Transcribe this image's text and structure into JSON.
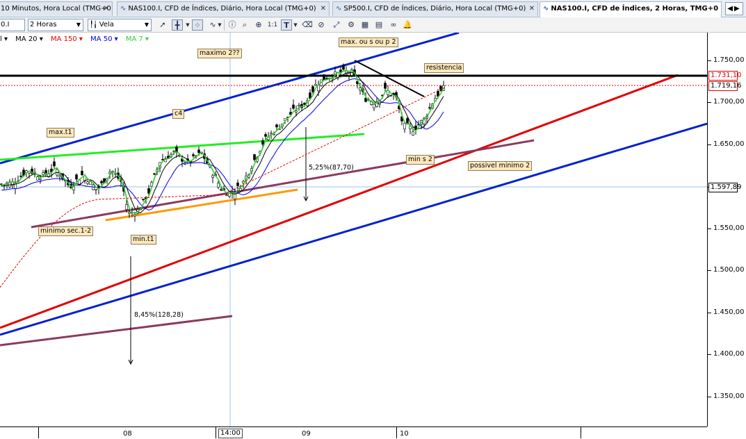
{
  "tabs": [
    {
      "label": "10 Minutos, Hora Local (TMG+0)",
      "active": false
    },
    {
      "label": "NAS100.I, CFD de Índices, Diário, Hora Local (TMG+0)",
      "active": false
    },
    {
      "label": "SP500.I, CFD de Índices, Diário, Hora Local (TMG+0)",
      "active": false
    },
    {
      "label": "NAS100.I, CFD de Índices, 2 Horas, TMG+0",
      "active": true
    }
  ],
  "toolbar": {
    "symbol_value": "0.I",
    "timeframe_value": "2 Horas",
    "chart_type_value": "Vela",
    "zoom_label": "1:1"
  },
  "legend": {
    "first": "l ▾",
    "ma20": "MA 20 ▾",
    "ma150": "MA 150 ▾",
    "ma50": "MA 50 ▾",
    "ma7": "MA 7 ▾",
    "colors": {
      "ma20": "#000000",
      "ma150": "#e00000",
      "ma50": "#0000e0",
      "ma7": "#33cc33"
    }
  },
  "annotations": {
    "maximo2": "maximo 2??",
    "max_ou_s": "max. ou s ou p 2",
    "resistencia": "resistencia",
    "c4": "c4",
    "max_t1": "max.t1",
    "min_s2": "min s  2",
    "possivel_minimo2": "possivel minimo 2",
    "minimo_sec": "minimo sec.1-2",
    "min_t1": "min.t1",
    "measure1": "5,25%(87,70)",
    "measure2": "8,45%(128,28)"
  },
  "price_axis": {
    "ticks": [
      "1.750,00",
      "1.700,00",
      "1.650,00",
      "1.600,00",
      "1.550,00",
      "1.500,00",
      "1.450,00",
      "1.400,00",
      "1.350,00"
    ],
    "tags": {
      "resistance": "1.731,10",
      "current": "1.719,16",
      "crosshair": "1.597,89"
    }
  },
  "time_axis": {
    "labels": [
      "08",
      "09",
      "10"
    ],
    "cursor": "14:00"
  },
  "colors": {
    "red_line": "#e00000",
    "blue_line": "#0022cc",
    "green_trend": "#22ee22",
    "purple_trend": "#8b3a5f",
    "orange_trend": "#ff9900",
    "bull_candle": "#ffffff",
    "bear_candle": "#000000"
  }
}
